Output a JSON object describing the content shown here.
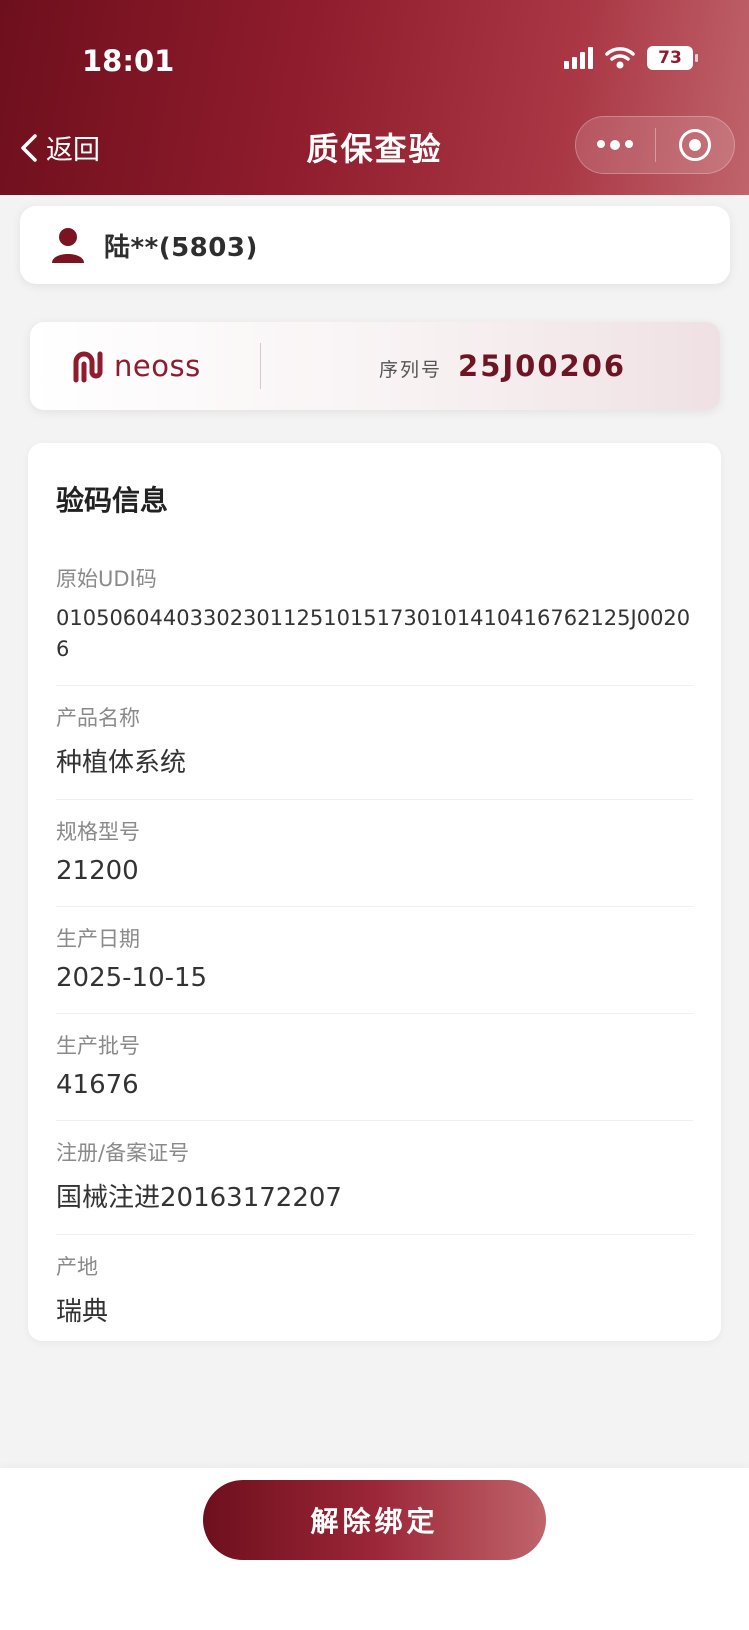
{
  "status_bar": {
    "time": "18:01",
    "battery": "73"
  },
  "nav": {
    "back_label": "返回",
    "title": "质保查验"
  },
  "user": {
    "name": "陆**(5803)"
  },
  "product_header": {
    "brand": "neoss",
    "serial_label": "序列号",
    "serial_value": "25J00206"
  },
  "info": {
    "title": "验码信息",
    "fields": [
      {
        "label": "原始UDI码",
        "value": "01050604403302301125101517301014104167621​25J00206"
      },
      {
        "label": "产品名称",
        "value": "种植体系统"
      },
      {
        "label": "规格型号",
        "value": "21200"
      },
      {
        "label": "生产日期",
        "value": "2025-10-15"
      },
      {
        "label": "生产批号",
        "value": "41676"
      },
      {
        "label": "注册/备案证号",
        "value": "国械注进20163172207"
      },
      {
        "label": "产地",
        "value": "瑞典"
      }
    ]
  },
  "actions": {
    "unbind_label": "解除绑定"
  },
  "colors": {
    "brand": "#8f1c2c",
    "brand_dark": "#6e0f1d"
  }
}
